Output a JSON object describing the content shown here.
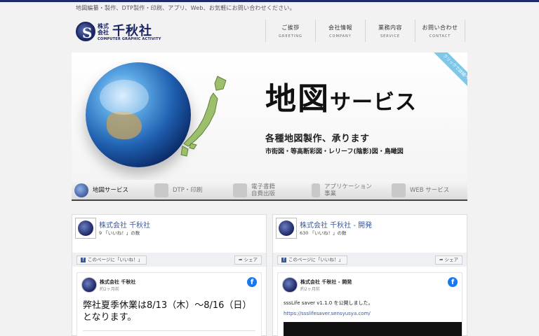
{
  "header": {
    "tagline": "地図編纂・製作、DTP製作・印刷、アプリ、Web、お気軽にお問い合わせください。",
    "logo": {
      "mark": "S",
      "small": "株式会社",
      "name": "千秋社",
      "sub": "COMPUTER GRAPHIC ACTIVITY"
    }
  },
  "gnav": [
    {
      "jp": "ご挨拶",
      "en": "GREETING"
    },
    {
      "jp": "会社情報",
      "en": "COMPANY"
    },
    {
      "jp": "業務内容",
      "en": "SERVICE"
    },
    {
      "jp": "お問い合わせ",
      "en": "CONTACT"
    }
  ],
  "hero": {
    "title_big": "地図",
    "title_rest": "サービス",
    "sub1": "各種地図製作、承ります",
    "sub2": "市街図・等高断彩図・レリーフ(陰影)図・鳥瞰図",
    "ribbon": "クリックで詳細へ"
  },
  "services": [
    {
      "label": "地図サービス",
      "icon": "globe-icon"
    },
    {
      "label": "DTP・印刷",
      "icon": "printer-icon"
    },
    {
      "label1": "電子書籍",
      "label2": "自費出版",
      "icon": "ebook-icon"
    },
    {
      "label1": "アプリケーション",
      "label2": "事業",
      "icon": "smartphone-icon"
    },
    {
      "label": "WEB サービス",
      "icon": "house-icon"
    }
  ],
  "panels": [
    {
      "page_name": "株式会社 千秋社",
      "likes": "9 「いいね！」の数",
      "like_btn": "このページに「いいね！」",
      "share_btn": "シェア",
      "post": {
        "author": "株式会社 千秋社",
        "time": "約2ヶ月前",
        "text": "弊社夏季休業は8/13（木）〜8/16（日）となります。"
      }
    },
    {
      "page_name": "株式会社 千秋社 - 開発",
      "likes": "630 「いいね！」の数",
      "like_btn": "このページに「いいね！」",
      "share_btn": "シェア",
      "post": {
        "author": "株式会社 千秋社 - 開発",
        "time": "約2ヶ月前",
        "text": "sssLife saver v1.1.0 を公開しました。",
        "link": "https://ssslifesaver.sensyusya.com/"
      }
    }
  ],
  "colors": {
    "brand": "#1a2463",
    "facebook": "#1877f2",
    "link": "#365899"
  }
}
